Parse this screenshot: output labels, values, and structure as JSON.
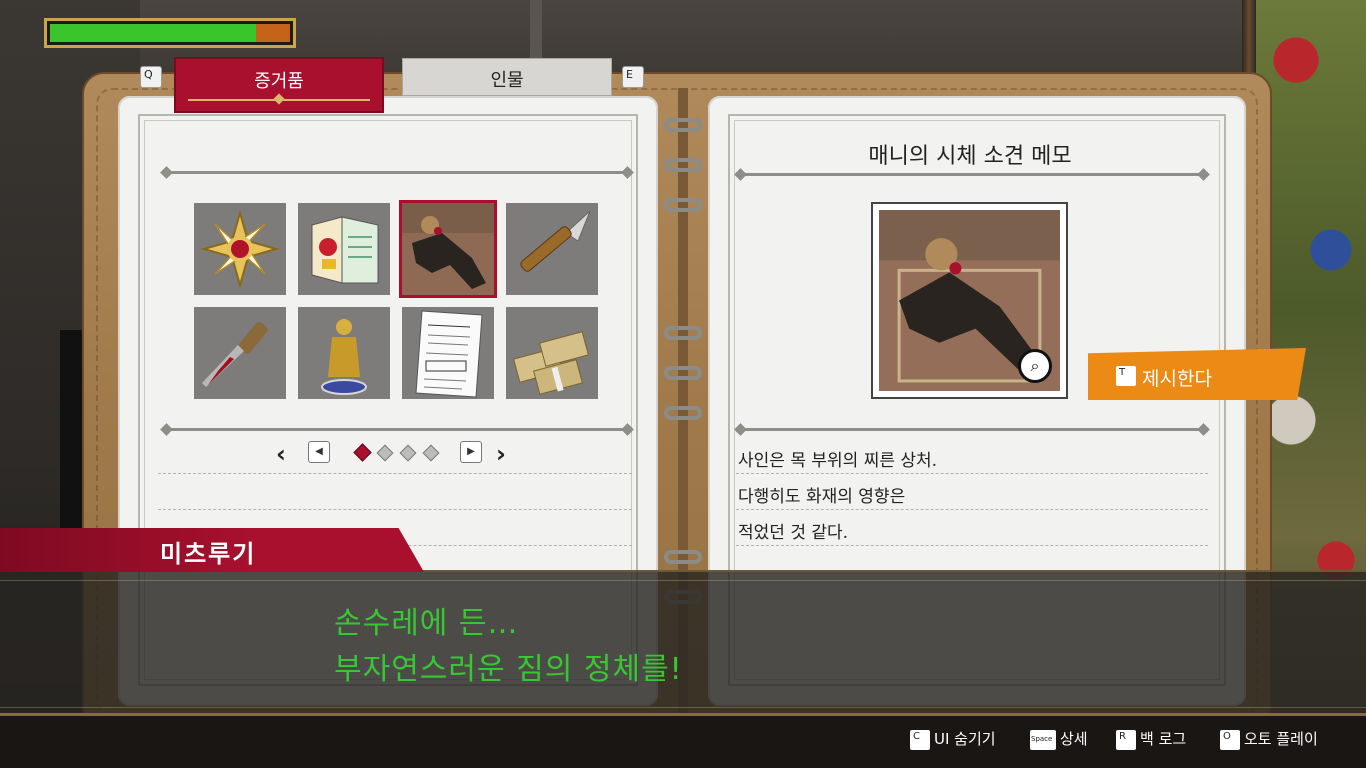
{
  "health": {
    "value": 0.86,
    "fill_color": "#3ac52c",
    "track_color": "#c6631b"
  },
  "tabs": {
    "left_key": "Q",
    "right_key": "E",
    "evidence_label": "증거품",
    "people_label": "인물",
    "active": "evidence"
  },
  "evidence_grid": {
    "items": [
      {
        "icon": "gold-badge-icon"
      },
      {
        "icon": "folded-map-icon"
      },
      {
        "icon": "corpse-photo-icon",
        "selected": true
      },
      {
        "icon": "knife-icon"
      },
      {
        "icon": "bloody-dagger-icon"
      },
      {
        "icon": "golden-statue-icon"
      },
      {
        "icon": "document-icon"
      },
      {
        "icon": "cash-bundles-icon"
      }
    ],
    "page_current": 1,
    "page_total": 4
  },
  "detail": {
    "title": "매니의 시체 소견 메모",
    "image_icon": "corpse-photo-icon",
    "present_key": "T",
    "present_label": "제시한다",
    "description": [
      "사인은 목 부위의 찌른 상처.",
      "다행히도 화재의 영향은",
      "적었던 것 같다."
    ]
  },
  "dialogue": {
    "speaker": "미츠루기",
    "lines": [
      "손수레에 든…",
      "부자연스러운 짐의 정체를!"
    ],
    "text_color": "#36c832"
  },
  "controls": [
    {
      "key": "C",
      "label": "UI 숨기기"
    },
    {
      "key": "Space",
      "label": "상세"
    },
    {
      "key": "R",
      "label": "백 로그"
    },
    {
      "key": "O",
      "label": "오토 플레이"
    }
  ],
  "colors": {
    "accent_red": "#a8102e",
    "present_orange": "#ec8a16",
    "page": "#f2f2f0"
  }
}
